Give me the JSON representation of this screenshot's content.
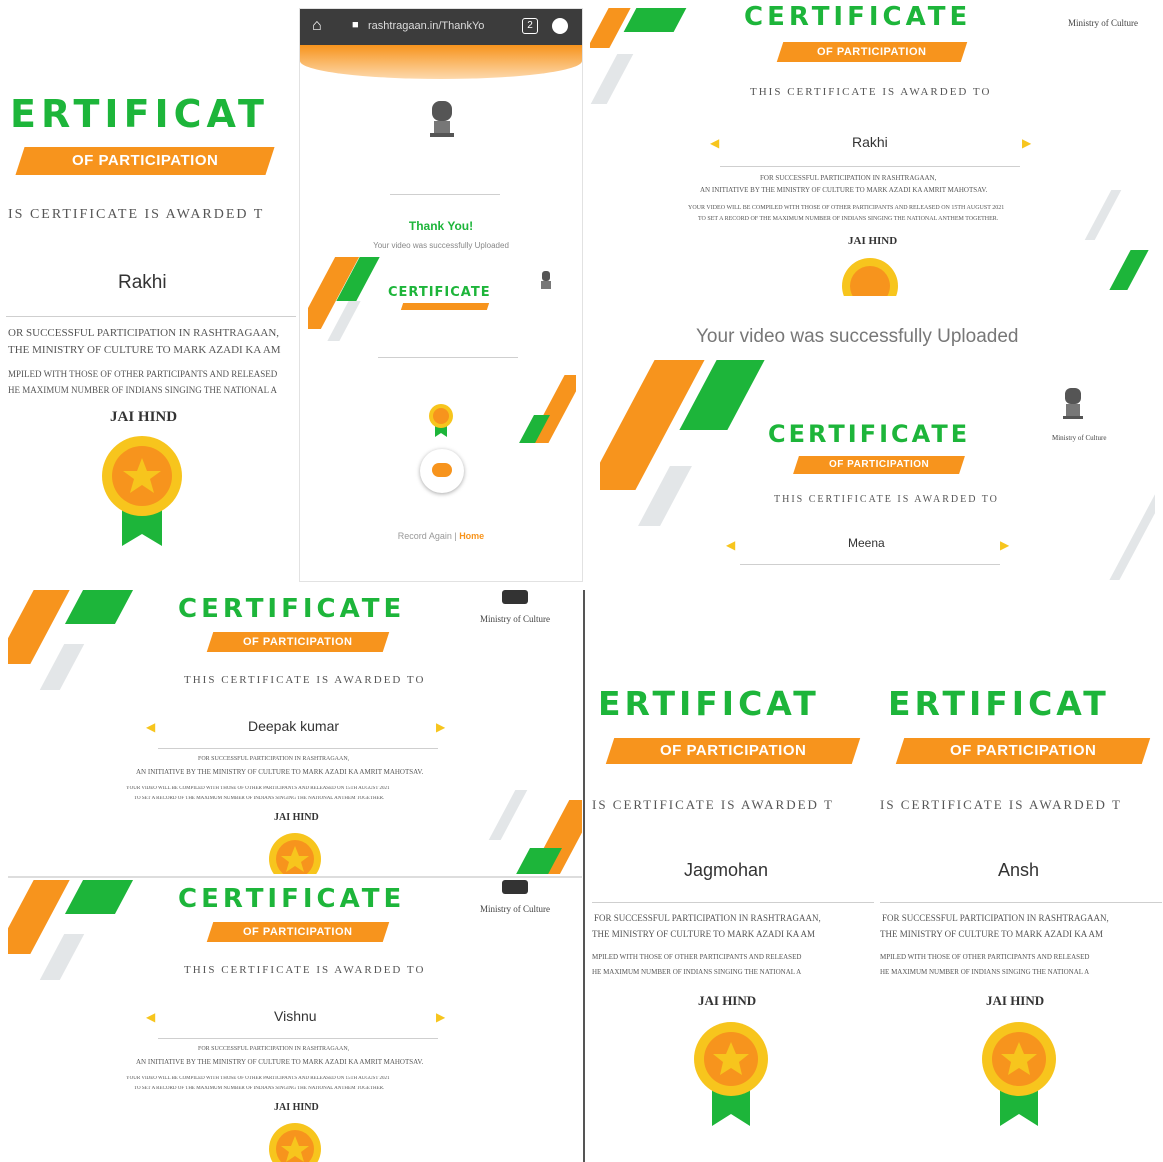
{
  "certificate": {
    "title": "CERTIFICATE",
    "title_cut": "ERTIFICAT",
    "subtitle": "OF PARTICIPATION",
    "awarded": "THIS CERTIFICATE IS AWARDED TO",
    "awarded_cut": "IS CERTIFICATE IS AWARDED T",
    "line1": "FOR SUCCESSFUL PARTICIPATION IN RASHTRAGAAN,",
    "line2": "AN INITIATIVE BY THE MINISTRY OF CULTURE TO MARK AZADI KA AMRIT MAHOTSAV.",
    "line3": "YOUR VIDEO WILL BE COMPILED WITH THOSE OF OTHER PARTICIPANTS AND RELEASED ON 15TH AUGUST 2021",
    "line4": "TO SET A RECORD OF THE MAXIMUM NUMBER OF INDIANS SINGING THE NATIONAL ANTHEM TOGETHER.",
    "line1_cut": "OR SUCCESSFUL PARTICIPATION IN RASHTRAGAAN,",
    "line2_cut": "THE MINISTRY OF CULTURE TO MARK AZADI KA AM",
    "line3_cut": "MPILED WITH THOSE OF OTHER PARTICIPANTS AND RELEASED",
    "line4_cut": "HE MAXIMUM NUMBER OF INDIANS SINGING THE NATIONAL A",
    "closing": "JAI HIND",
    "ministry": "Ministry of Culture"
  },
  "recipients": {
    "rakhi": "Rakhi",
    "meena": "Meena",
    "deepak": "Deepak kumar",
    "vishnu": "Vishnu",
    "jagmohan": "Jagmohan",
    "ansh": "Ansh"
  },
  "phone": {
    "url": "rashtragaan.in/ThankYo",
    "tab_count": "2",
    "thank_title": "Thank You!",
    "thank_sub": "Your video was successfully Uploaded",
    "record_again": "Record Again",
    "home": "Home"
  },
  "colors": {
    "green": "#1db53a",
    "orange": "#f7941d",
    "gold": "#f7c51d"
  }
}
